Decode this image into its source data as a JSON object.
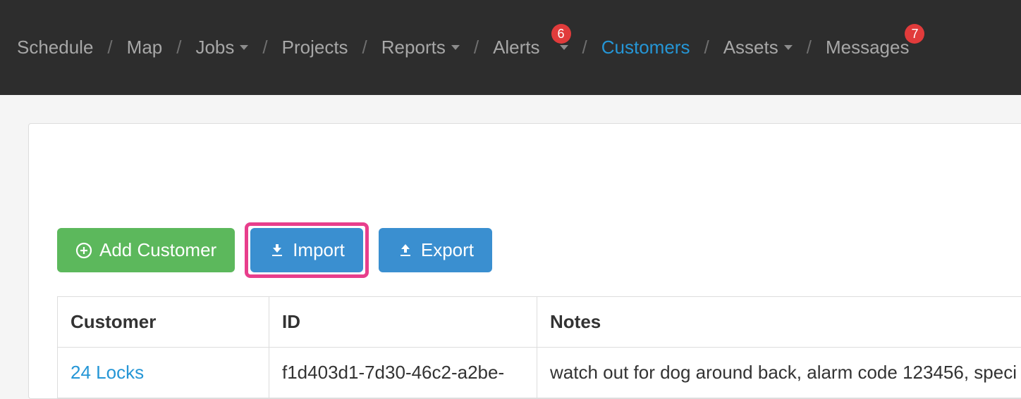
{
  "nav": {
    "items": [
      {
        "label": "Schedule",
        "hasCaret": false,
        "active": false,
        "badge": null
      },
      {
        "label": "Map",
        "hasCaret": false,
        "active": false,
        "badge": null
      },
      {
        "label": "Jobs",
        "hasCaret": true,
        "active": false,
        "badge": null
      },
      {
        "label": "Projects",
        "hasCaret": false,
        "active": false,
        "badge": null
      },
      {
        "label": "Reports",
        "hasCaret": true,
        "active": false,
        "badge": null
      },
      {
        "label": "Alerts",
        "hasCaret": true,
        "active": false,
        "badge": "6"
      },
      {
        "label": "Customers",
        "hasCaret": false,
        "active": true,
        "badge": null
      },
      {
        "label": "Assets",
        "hasCaret": true,
        "active": false,
        "badge": null
      },
      {
        "label": "Messages",
        "hasCaret": false,
        "active": false,
        "badge": "7"
      }
    ]
  },
  "buttons": {
    "add": "Add Customer",
    "import": "Import",
    "export": "Export"
  },
  "table": {
    "headers": {
      "customer": "Customer",
      "id": "ID",
      "notes": "Notes"
    },
    "rows": [
      {
        "customer": "24 Locks",
        "id": "f1d403d1-7d30-46c2-a2be-",
        "notes": "watch out for dog around back, alarm code 123456, speci"
      }
    ]
  },
  "highlight": "import"
}
